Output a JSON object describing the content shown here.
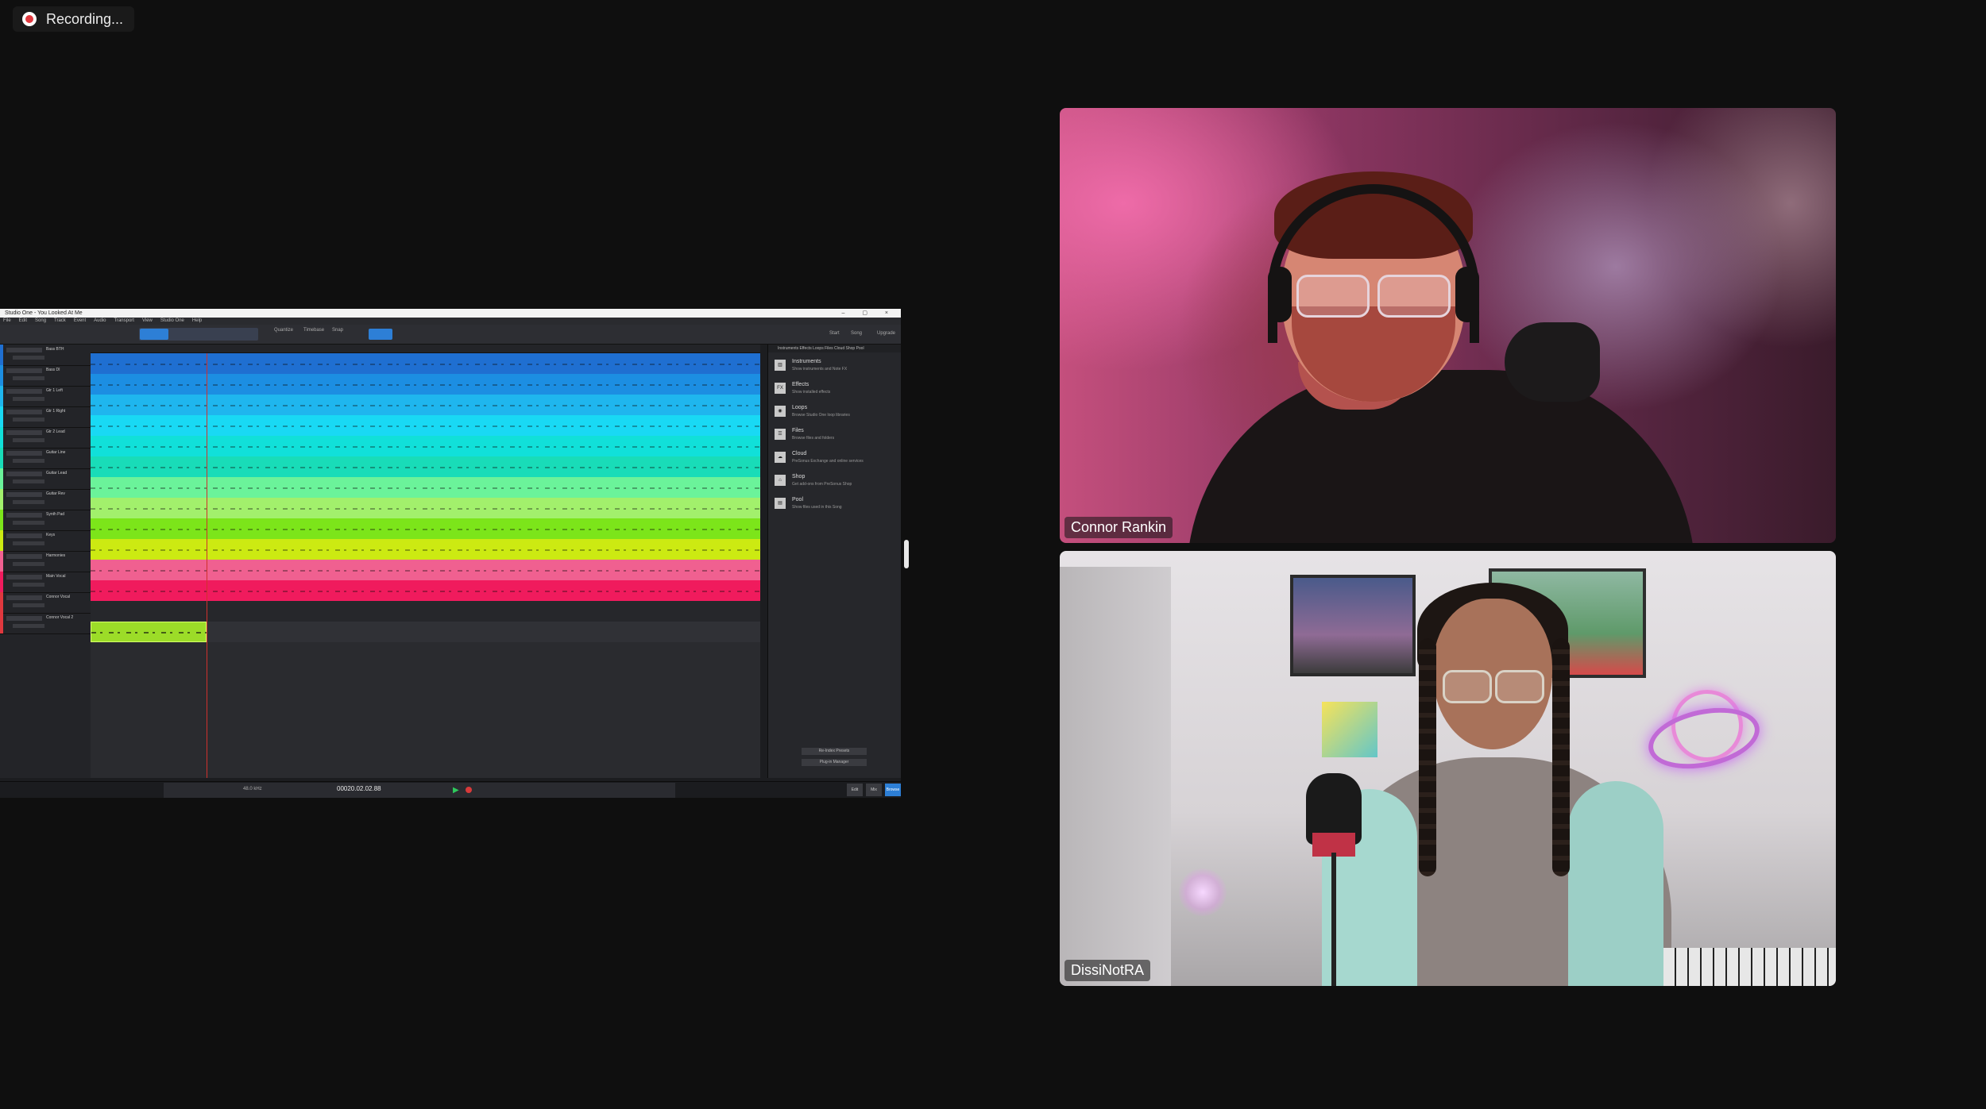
{
  "recording": {
    "label": "Recording..."
  },
  "daw": {
    "title": "Studio One - You Looked At Me",
    "window_controls": "– ▢ ×",
    "menu": [
      "File",
      "Edit",
      "Song",
      "Track",
      "Event",
      "Audio",
      "Transport",
      "View",
      "Studio One",
      "Help"
    ],
    "toolbar": {
      "quantize": "Quantize",
      "timebase": "Timebase",
      "snap": "Snap",
      "start": "Start",
      "song": "Song",
      "upgrade": "Upgrade"
    },
    "tracks": [
      {
        "name": "Bass BTH",
        "color": "#1f6fd1"
      },
      {
        "name": "Bass DI",
        "color": "#1c8ee2"
      },
      {
        "name": "Gtr 1 Left",
        "color": "#1fb6ee"
      },
      {
        "name": "Gtr 1 Right",
        "color": "#19d9f4"
      },
      {
        "name": "Gtr 2 Lead",
        "color": "#11e0d9"
      },
      {
        "name": "Guitar Line",
        "color": "#19dcb8"
      },
      {
        "name": "Guitar Lead",
        "color": "#6bf39a"
      },
      {
        "name": "Guitar Rev",
        "color": "#a2f06c"
      },
      {
        "name": "Synth Pad",
        "color": "#7ce51a"
      },
      {
        "name": "Keys",
        "color": "#ccea12"
      },
      {
        "name": "Harmonies",
        "color": "#f06090"
      },
      {
        "name": "Main Vocal",
        "color": "#f01b5d"
      },
      {
        "name": "Connor Vocal",
        "color": "#2a2b2f"
      },
      {
        "name": "Connor Vocal 2",
        "color": "#2a2b2f"
      }
    ],
    "browser": {
      "tabs": "Instruments   Effects   Loops   Files   Cloud   Shop   Pool",
      "items": [
        {
          "icon": "piano-icon",
          "glyph": "▥",
          "title": "Instruments",
          "desc": "Show instruments and Note FX"
        },
        {
          "icon": "fx-icon",
          "glyph": "FX",
          "title": "Effects",
          "desc": "Show installed effects"
        },
        {
          "icon": "loops-icon",
          "glyph": "◉",
          "title": "Loops",
          "desc": "Browse Studio One loop libraries"
        },
        {
          "icon": "files-icon",
          "glyph": "☰",
          "title": "Files",
          "desc": "Browse files and folders"
        },
        {
          "icon": "cloud-icon",
          "glyph": "☁",
          "title": "Cloud",
          "desc": "PreSonus Exchange and online services"
        },
        {
          "icon": "shop-icon",
          "glyph": "⌂",
          "title": "Shop",
          "desc": "Get add-ons from PreSonus Shop"
        },
        {
          "icon": "pool-icon",
          "glyph": "▤",
          "title": "Pool",
          "desc": "Show files used in this Song"
        }
      ],
      "buttons": [
        "Re-Index Presets",
        "Plug-in Manager"
      ]
    },
    "transport": {
      "time": "00020.02.02.88",
      "sample_rate": "48.0 kHz",
      "right_buttons": [
        "Edit",
        "Mix",
        "Browse"
      ]
    }
  },
  "participants": [
    {
      "name": "Connor Rankin"
    },
    {
      "name": "DissiNotRA"
    }
  ]
}
